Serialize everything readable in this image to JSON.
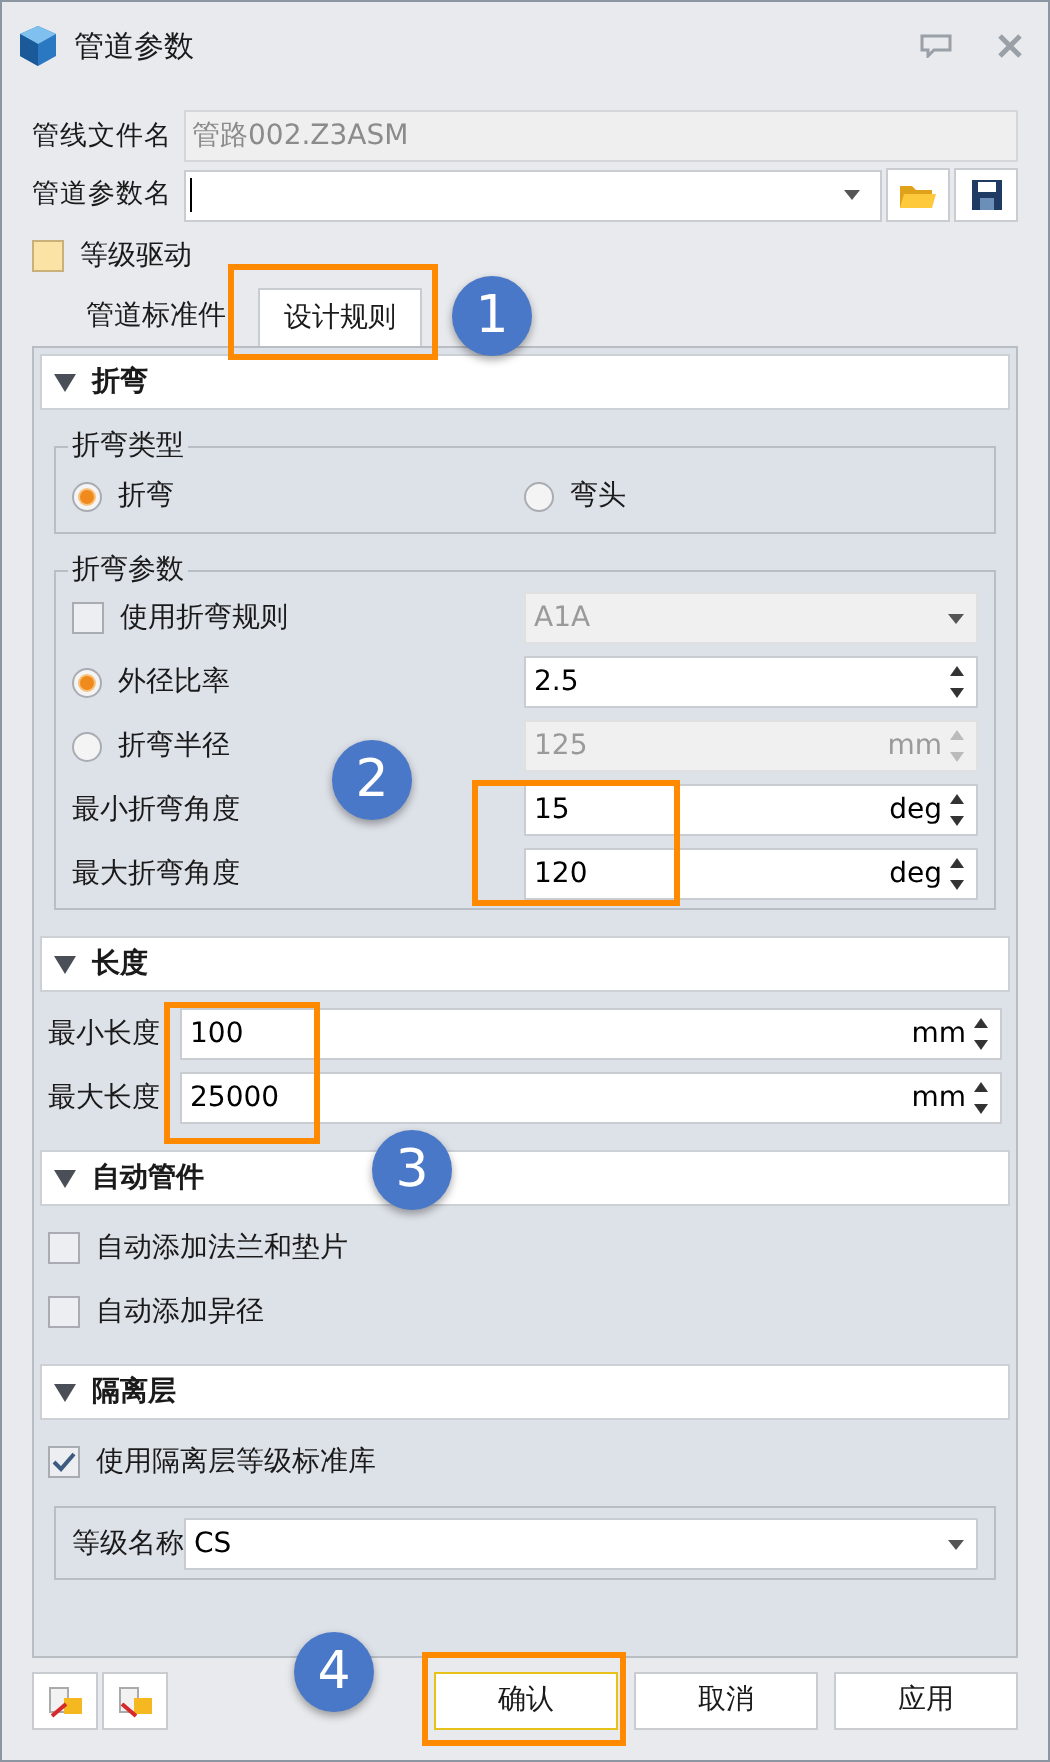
{
  "window": {
    "title": "管道参数"
  },
  "file_name": {
    "label": "管线文件名",
    "value": "管路002.Z3ASM",
    "disabled": true
  },
  "param_name": {
    "label": "管道参数名"
  },
  "grade_driven": {
    "label": "等级驱动",
    "checked": false
  },
  "tabs": [
    {
      "label": "管道标准件",
      "selected": false
    },
    {
      "label": "设计规则",
      "selected": true
    }
  ],
  "sections": [
    {
      "title": "折弯",
      "items": [
        {
          "kind": "group",
          "title": "折弯类型",
          "items": [
            {
              "kind": "radio_row",
              "options": [
                {
                  "label": "折弯",
                  "selected": true
                },
                {
                  "label": "弯头",
                  "selected": false
                }
              ]
            }
          ]
        },
        {
          "kind": "group",
          "title": "折弯参数",
          "items": [
            {
              "kind": "checkbox",
              "label": "使用折弯规则",
              "checked": false,
              "field": {
                "kind": "dropdown",
                "value": "A1A",
                "disabled": true
              }
            },
            {
              "kind": "radio",
              "label": "外径比率",
              "selected": true,
              "field": {
                "kind": "spin",
                "value": "2.5",
                "disabled": false
              }
            },
            {
              "kind": "radio",
              "label": "折弯半径",
              "selected": false,
              "field": {
                "kind": "spin",
                "value": "125",
                "unit": "mm",
                "disabled": true
              }
            },
            {
              "kind": "plain",
              "label": "最小折弯角度",
              "field": {
                "kind": "spin",
                "value": "15",
                "unit": "deg",
                "disabled": false
              }
            },
            {
              "kind": "plain",
              "label": "最大折弯角度",
              "field": {
                "kind": "spin",
                "value": "120",
                "unit": "deg",
                "disabled": false
              }
            }
          ]
        }
      ]
    },
    {
      "title": "长度",
      "items": [
        {
          "kind": "plain",
          "label": "最小长度",
          "field": {
            "kind": "spin",
            "value": "100",
            "unit": "mm",
            "disabled": false
          }
        },
        {
          "kind": "plain",
          "label": "最大长度",
          "field": {
            "kind": "spin",
            "value": "25000",
            "unit": "mm",
            "disabled": false
          }
        }
      ]
    },
    {
      "title": "自动管件",
      "items": [
        {
          "kind": "checkbox",
          "label": "自动添加法兰和垫片",
          "checked": false
        },
        {
          "kind": "checkbox",
          "label": "自动添加异径",
          "checked": false
        }
      ]
    },
    {
      "title": "隔离层",
      "items": [
        {
          "kind": "checkbox",
          "label": "使用隔离层等级标准库",
          "checked": true
        },
        {
          "kind": "group",
          "items": [
            {
              "kind": "plain",
              "label": "等级名称",
              "field": {
                "kind": "dropdown",
                "value": "CS",
                "disabled": false
              }
            }
          ]
        }
      ]
    }
  ],
  "buttons": [
    {
      "label": "确认",
      "focused": true
    },
    {
      "label": "取消",
      "focused": false
    },
    {
      "label": "应用",
      "focused": false
    }
  ],
  "callouts": [
    {
      "number": "1"
    },
    {
      "number": "2"
    },
    {
      "number": "3"
    },
    {
      "number": "4"
    }
  ]
}
